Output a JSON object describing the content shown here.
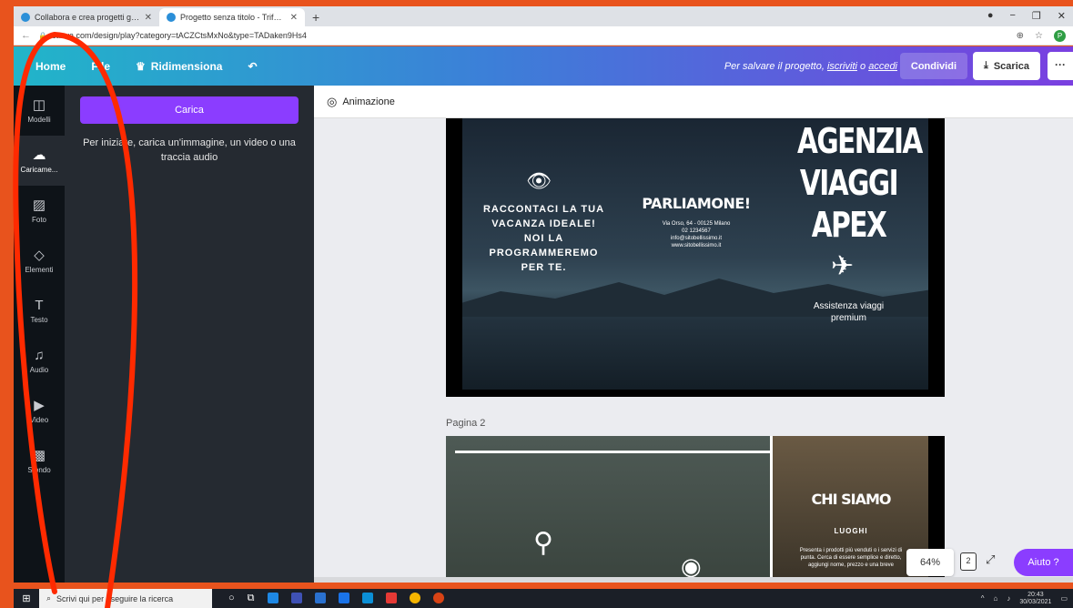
{
  "browser": {
    "tabs": [
      {
        "title": "Collabora e crea progetti grafic"
      },
      {
        "title": "Progetto senza titolo - Trifold Br"
      }
    ],
    "new_tab": "+",
    "url": "canva.com/design/play?category=tACZCtsMxNo&type=TADaken9Hs4",
    "profile_initial": "P"
  },
  "topbar": {
    "home": "Home",
    "file": "File",
    "resize": "Ridimensiona",
    "save_msg_prefix": "Per salvare il progetto,",
    "save_msg_signup": "iscriviti",
    "save_msg_or": "o",
    "save_msg_login": "accedi",
    "share": "Condividi",
    "download": "Scarica",
    "more": "···"
  },
  "rail": {
    "items": [
      {
        "label": "Modelli",
        "icon": "layout-icon"
      },
      {
        "label": "Caricame...",
        "icon": "upload-cloud-icon"
      },
      {
        "label": "Foto",
        "icon": "photo-icon"
      },
      {
        "label": "Elementi",
        "icon": "shapes-icon"
      },
      {
        "label": "Testo",
        "icon": "text-icon"
      },
      {
        "label": "Audio",
        "icon": "music-icon"
      },
      {
        "label": "Video",
        "icon": "video-icon"
      },
      {
        "label": "Sfondo",
        "icon": "background-pattern-icon"
      }
    ]
  },
  "panel": {
    "upload_button": "Carica",
    "hint": "Per iniziare, carica un'immagine, un video o una traccia audio"
  },
  "editor": {
    "animation": "Animazione",
    "page1": {
      "col1": "RACCONTACI LA TUA VACANZA IDEALE! NOI LA PROGRAMMEREMO PER TE.",
      "col2_title": "PARLIAMONE!",
      "col2_address": "Via Orso, 64 - 00125 Milano",
      "col2_phone": "02 1234567",
      "col2_email": "info@sitobellissimo.it",
      "col2_web": "www.sitobellissimo.it",
      "brand_line1": "AGENZIA",
      "brand_line2": "VIAGGI",
      "brand_line3": "APEX",
      "assist": "Assistenza viaggi premium"
    },
    "page2_label": "Pagina 2",
    "page2": {
      "title": "CHI SIAMO",
      "subtitle": "LUOGHI",
      "text": "Presenta i prodotti più venduti o i servizi di punta. Cerca di essere semplice e diretto, aggiungi nome, prezzo e una breve"
    },
    "zoom": "64%",
    "page_count": "2",
    "help": "Aiuto ?"
  },
  "taskbar": {
    "search_placeholder": "Scrivi qui per eseguire la ricerca",
    "time": "20:43",
    "date": "30/03/2021"
  },
  "colors": {
    "accent": "#8b3dff",
    "annotation": "#ff2a00",
    "background": "#e8531d"
  }
}
